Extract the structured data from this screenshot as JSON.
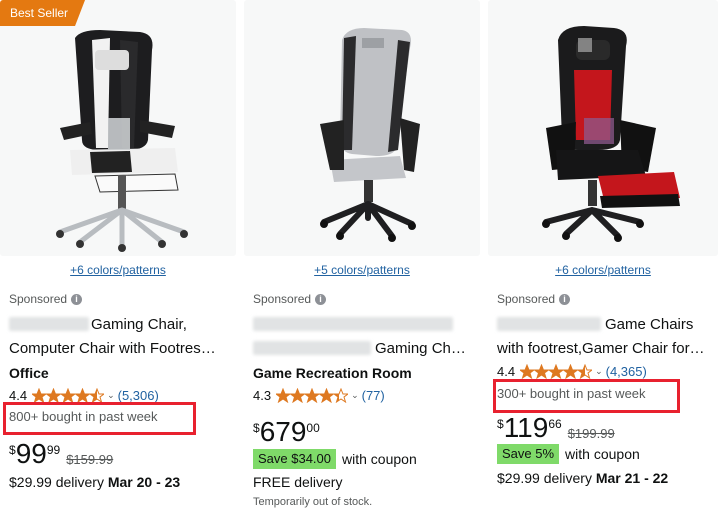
{
  "products": [
    {
      "badge": "Best Seller",
      "colors_link": "+6 colors/patterns",
      "sponsored": "Sponsored",
      "title_line1": "Gaming Chair,",
      "title_line2": "Computer Chair with Footres…",
      "title_line3": "Office",
      "rating": "4.4",
      "review_count": "(5,306)",
      "bought": "800+ bought in past week",
      "price_symbol": "$",
      "price_whole": "99",
      "price_fraction": "99",
      "list_price": "$159.99",
      "delivery_price": "$29.99 delivery",
      "delivery_dates": "Mar 20 - 23"
    },
    {
      "colors_link": "+5 colors/patterns",
      "sponsored": "Sponsored",
      "title_line1": "Gaming Ch…",
      "title_line2": "Game Recreation Room",
      "rating": "4.3",
      "review_count": "(77)",
      "price_symbol": "$",
      "price_whole": "679",
      "price_fraction": "00",
      "save_badge": "Save $34.00",
      "coupon_text": "with coupon",
      "delivery_text": "FREE delivery",
      "stock_note": "Temporarily out of stock."
    },
    {
      "colors_link": "+6 colors/patterns",
      "sponsored": "Sponsored",
      "title_line1": "Game Chairs",
      "title_line2": "with footrest,Gamer Chair for…",
      "rating": "4.4",
      "review_count": "(4,365)",
      "bought": "300+ bought in past week",
      "price_symbol": "$",
      "price_whole": "119",
      "price_fraction": "66",
      "list_price": "$199.99",
      "save_badge": "Save 5%",
      "coupon_text": "with coupon",
      "delivery_price": "$29.99 delivery",
      "delivery_dates": "Mar 21 - 22"
    }
  ],
  "colors": {
    "badge": "#e47911",
    "star": "#de7921",
    "link": "#2162a1",
    "save": "#7fda69",
    "highlight": "#e8212f"
  }
}
